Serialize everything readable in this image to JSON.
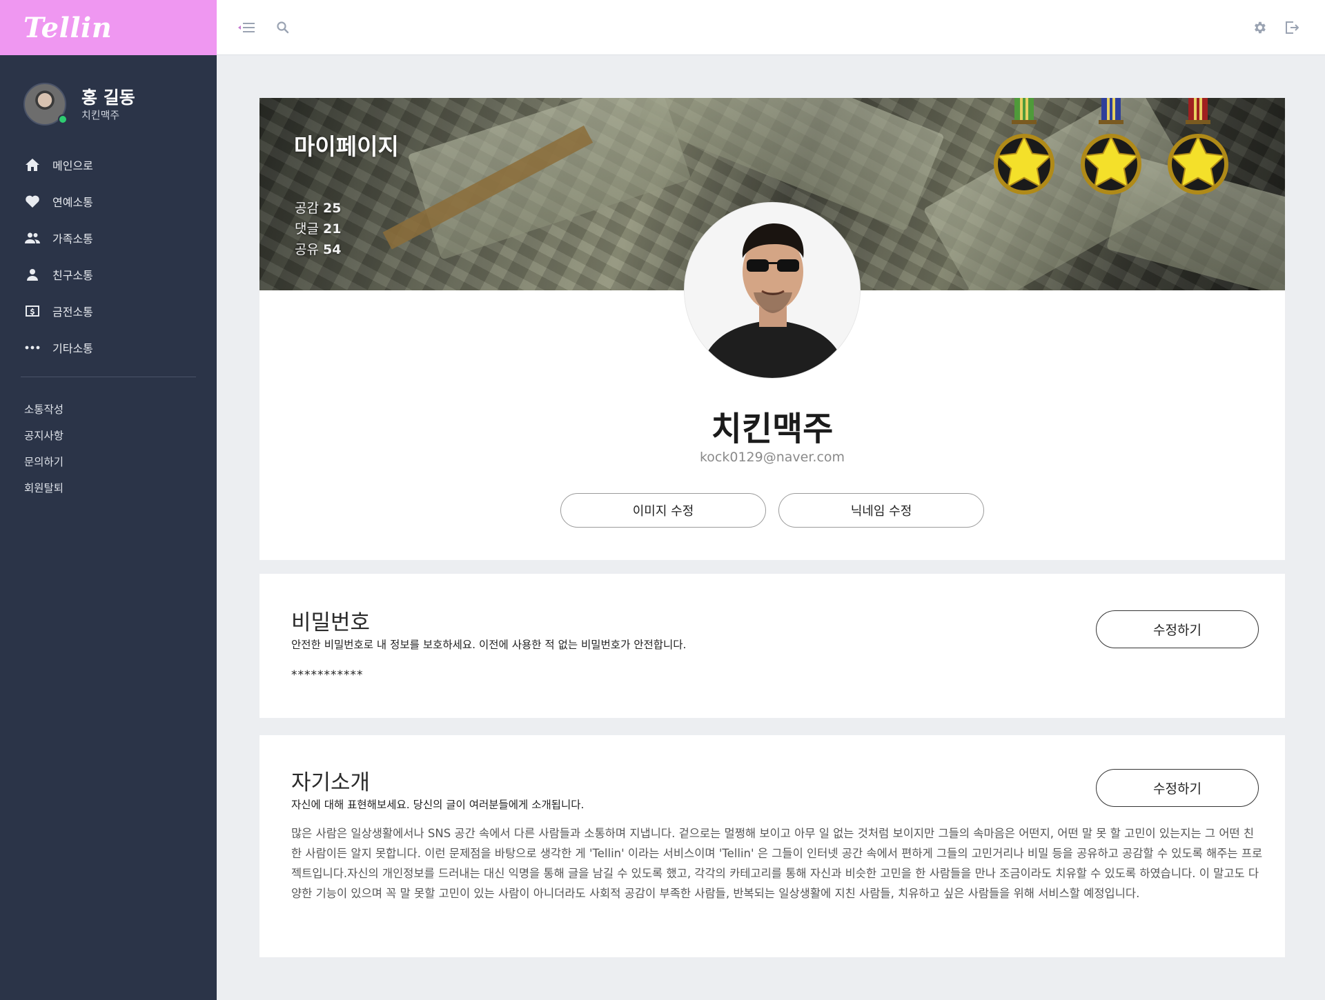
{
  "app": {
    "brand": "Tellin"
  },
  "user": {
    "name": "홍 길동",
    "nickname": "치킨맥주",
    "online": true
  },
  "nav": {
    "items": [
      {
        "label": "메인으로",
        "icon": "home-icon"
      },
      {
        "label": "연예소통",
        "icon": "heart-icon"
      },
      {
        "label": "가족소통",
        "icon": "people-icon"
      },
      {
        "label": "친구소통",
        "icon": "person-icon"
      },
      {
        "label": "금전소통",
        "icon": "money-icon"
      },
      {
        "label": "기타소통",
        "icon": "more-icon"
      }
    ],
    "sub_items": [
      {
        "label": "소통작성"
      },
      {
        "label": "공지사항"
      },
      {
        "label": "문의하기"
      },
      {
        "label": "회원탈퇴"
      }
    ]
  },
  "topbar": {
    "left_icons": [
      "menu-toggle-icon",
      "search-icon"
    ],
    "right_icons": [
      "settings-icon",
      "logout-icon"
    ]
  },
  "profile": {
    "banner_title": "마이페이지",
    "stats": [
      {
        "label": "공감",
        "value": "25"
      },
      {
        "label": "댓글",
        "value": "21"
      },
      {
        "label": "공유",
        "value": "54"
      }
    ],
    "medals": [
      {
        "ribbon_color": "#4f9a3a"
      },
      {
        "ribbon_color": "#2f3f9a"
      },
      {
        "ribbon_color": "#a02020"
      }
    ],
    "nickname": "치킨맥주",
    "email": "kock0129@naver.com",
    "edit_image_label": "이미지 수정",
    "edit_nickname_label": "닉네임 수정"
  },
  "password": {
    "title": "비밀번호",
    "description": "안전한 비밀번호로 내 정보를 보호하세요. 이전에 사용한 적 없는 비밀번호가 안전합니다.",
    "masked": "***********",
    "edit_label": "수정하기"
  },
  "intro": {
    "title": "자기소개",
    "description": "자신에 대해 표현해보세요. 당신의 글이 여러분들에게 소개됩니다.",
    "body": "많은 사람은 일상생활에서나 SNS 공간 속에서 다른 사람들과 소통하며 지냅니다. 겉으로는 멀쩡해 보이고 아무 일 없는 것처럼 보이지만 그들의 속마음은 어떤지, 어떤 말 못 할 고민이 있는지는 그 어떤 친한 사람이든 알지 못합니다. 이런 문제점을 바탕으로 생각한 게 'Tellin' 이라는 서비스이며 'Tellin' 은 그들이 인터넷 공간 속에서 편하게 그들의 고민거리나 비밀 등을 공유하고 공감할 수 있도록 해주는 프로젝트입니다.자신의 개인정보를 드러내는 대신 익명을 통해 글을 남길 수 있도록 했고, 각각의 카테고리를 통해 자신과 비슷한 고민을 한 사람들을 만나 조금이라도 치유할 수 있도록 하였습니다. 이 말고도 다양한 기능이 있으며 꼭 말 못할 고민이 있는 사람이 아니더라도 사회적 공감이 부족한 사람들, 반복되는 일상생활에 지친 사람들, 치유하고 싶은 사람들을 위해 서비스할 예정입니다.",
    "edit_label": "수정하기"
  },
  "colors": {
    "sidebar_bg": "#2b3448",
    "brand_bg": "#ef97f1",
    "page_bg": "#eceef1",
    "online": "#2ecc71"
  }
}
